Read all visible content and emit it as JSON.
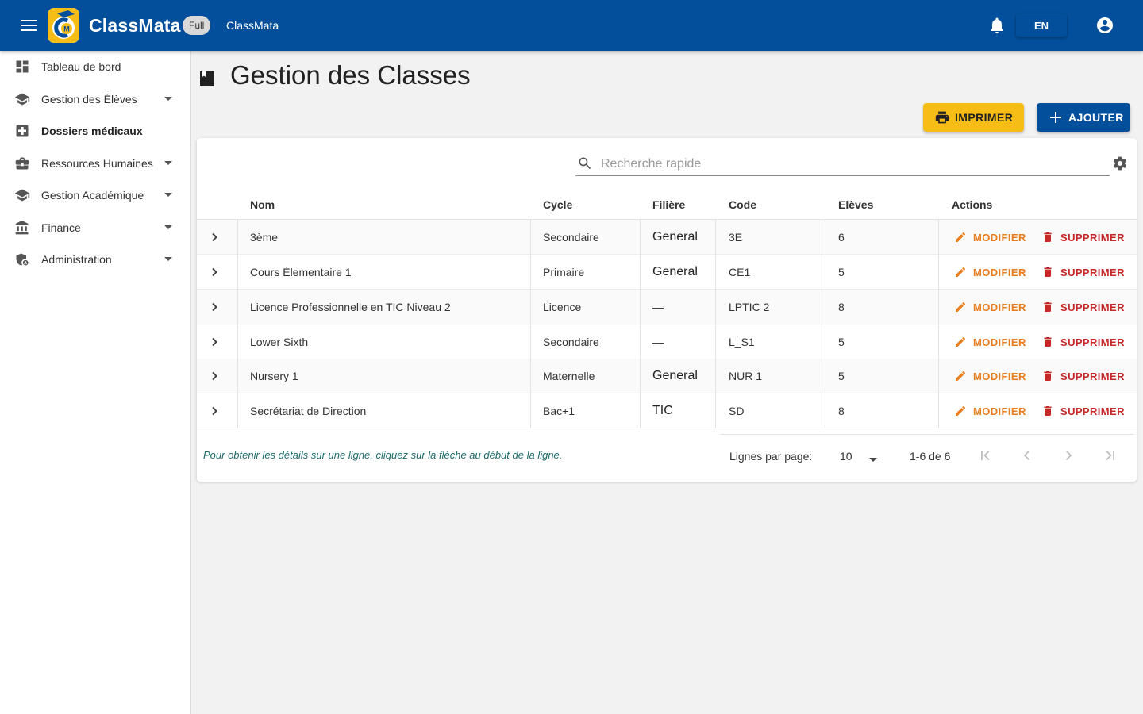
{
  "appbar": {
    "brand": "ClassMata",
    "badge": "Full",
    "subtitle": "ClassMata",
    "language": "EN",
    "color": "#034f9b"
  },
  "sidebar": {
    "items": [
      {
        "label": "Tableau de bord",
        "icon": "dashboard-icon",
        "bold": false,
        "expandable": false
      },
      {
        "label": "Gestion des Élèves",
        "icon": "school-icon",
        "bold": false,
        "expandable": true
      },
      {
        "label": "Dossiers médicaux",
        "icon": "medical-icon",
        "bold": true,
        "expandable": false
      },
      {
        "label": "Ressources Humaines",
        "icon": "briefcase-icon",
        "bold": false,
        "expandable": true
      },
      {
        "label": "Gestion Académique",
        "icon": "school-icon",
        "bold": false,
        "expandable": true
      },
      {
        "label": "Finance",
        "icon": "bank-icon",
        "bold": false,
        "expandable": true
      },
      {
        "label": "Administration",
        "icon": "admin-shield-icon",
        "bold": false,
        "expandable": true
      }
    ]
  },
  "page": {
    "title": "Gestion des Classes",
    "print_label": "IMPRIMER",
    "add_label": "AJOUTER",
    "print_color": "#f7bd17"
  },
  "search": {
    "placeholder": "Recherche rapide",
    "value": ""
  },
  "table": {
    "columns": [
      "Nom",
      "Cycle",
      "Filière",
      "Code",
      "Elèves",
      "Actions"
    ],
    "edit_label": "MODIFIER",
    "delete_label": "SUPPRIMER",
    "edit_color": "#e87d1e",
    "delete_color": "#c62828",
    "rows": [
      {
        "nom": "3ème",
        "cycle": "Secondaire",
        "filiere": "General",
        "code": "3E",
        "eleves": "6"
      },
      {
        "nom": "Cours Élementaire 1",
        "cycle": "Primaire",
        "filiere": "General",
        "code": "CE1",
        "eleves": "5"
      },
      {
        "nom": "Licence Professionnelle en TIC Niveau 2",
        "cycle": "Licence",
        "filiere": "—",
        "code": "LPTIC 2",
        "eleves": "8"
      },
      {
        "nom": "Lower Sixth",
        "cycle": "Secondaire",
        "filiere": "—",
        "code": "L_S1",
        "eleves": "5"
      },
      {
        "nom": "Nursery 1",
        "cycle": "Maternelle",
        "filiere": "General",
        "code": "NUR 1",
        "eleves": "5"
      },
      {
        "nom": "Secrétariat de Direction",
        "cycle": "Bac+1",
        "filiere": "TIC",
        "code": "SD",
        "eleves": "8"
      }
    ]
  },
  "footer": {
    "hint": "Pour obtenir les détails sur une ligne, cliquez sur la flèche au début de la ligne.",
    "rows_per_page_label": "Lignes par page:",
    "rows_per_page": "10",
    "range": "1-6 de 6"
  }
}
